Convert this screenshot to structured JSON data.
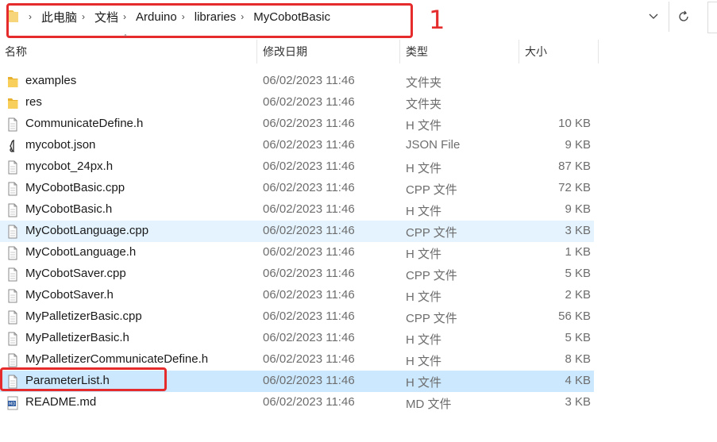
{
  "address_bar": {
    "crumbs": [
      "此电脑",
      "文档",
      "Arduino",
      "libraries",
      "MyCobotBasic"
    ]
  },
  "annotation": {
    "label": "1"
  },
  "columns": {
    "name": "名称",
    "date": "修改日期",
    "type": "类型",
    "size": "大小"
  },
  "files": [
    {
      "name": "examples",
      "date": "06/02/2023 11:46",
      "type": "文件夹",
      "size": "",
      "icon": "folder-icon"
    },
    {
      "name": "res",
      "date": "06/02/2023 11:46",
      "type": "文件夹",
      "size": "",
      "icon": "folder-icon"
    },
    {
      "name": "CommunicateDefine.h",
      "date": "06/02/2023 11:46",
      "type": "H 文件",
      "size": "10 KB",
      "icon": "document-icon"
    },
    {
      "name": "mycobot.json",
      "date": "06/02/2023 11:46",
      "type": "JSON File",
      "size": "9 KB",
      "icon": "json-icon"
    },
    {
      "name": "mycobot_24px.h",
      "date": "06/02/2023 11:46",
      "type": "H 文件",
      "size": "87 KB",
      "icon": "document-icon"
    },
    {
      "name": "MyCobotBasic.cpp",
      "date": "06/02/2023 11:46",
      "type": "CPP 文件",
      "size": "72 KB",
      "icon": "document-icon"
    },
    {
      "name": "MyCobotBasic.h",
      "date": "06/02/2023 11:46",
      "type": "H 文件",
      "size": "9 KB",
      "icon": "document-icon"
    },
    {
      "name": "MyCobotLanguage.cpp",
      "date": "06/02/2023 11:46",
      "type": "CPP 文件",
      "size": "3 KB",
      "icon": "document-icon",
      "state": "hover"
    },
    {
      "name": "MyCobotLanguage.h",
      "date": "06/02/2023 11:46",
      "type": "H 文件",
      "size": "1 KB",
      "icon": "document-icon"
    },
    {
      "name": "MyCobotSaver.cpp",
      "date": "06/02/2023 11:46",
      "type": "CPP 文件",
      "size": "5 KB",
      "icon": "document-icon"
    },
    {
      "name": "MyCobotSaver.h",
      "date": "06/02/2023 11:46",
      "type": "H 文件",
      "size": "2 KB",
      "icon": "document-icon"
    },
    {
      "name": "MyPalletizerBasic.cpp",
      "date": "06/02/2023 11:46",
      "type": "CPP 文件",
      "size": "56 KB",
      "icon": "document-icon"
    },
    {
      "name": "MyPalletizerBasic.h",
      "date": "06/02/2023 11:46",
      "type": "H 文件",
      "size": "5 KB",
      "icon": "document-icon"
    },
    {
      "name": "MyPalletizerCommunicateDefine.h",
      "date": "06/02/2023 11:46",
      "type": "H 文件",
      "size": "8 KB",
      "icon": "document-icon"
    },
    {
      "name": "ParameterList.h",
      "date": "06/02/2023 11:46",
      "type": "H 文件",
      "size": "4 KB",
      "icon": "document-icon",
      "state": "selected"
    },
    {
      "name": "README.md",
      "date": "06/02/2023 11:46",
      "type": "MD 文件",
      "size": "3 KB",
      "icon": "markdown-icon"
    }
  ],
  "colors": {
    "annotation": "#e52b2b",
    "selected": "#cce8ff",
    "hover": "#e5f3ff",
    "folder": "#f2c14e"
  }
}
